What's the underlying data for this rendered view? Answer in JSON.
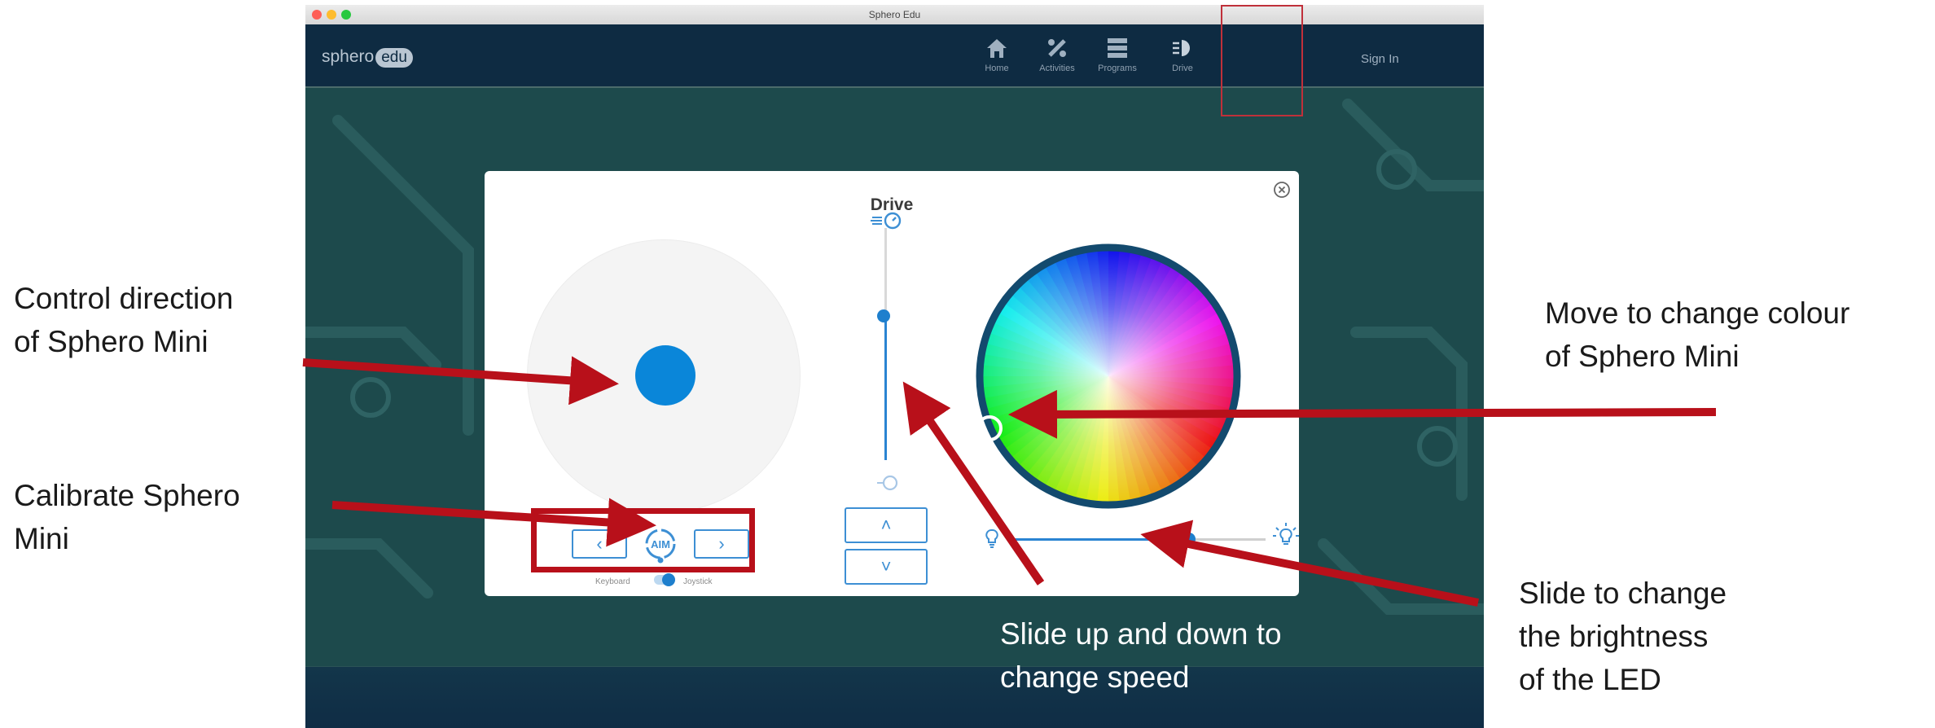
{
  "window": {
    "title": "Sphero Edu",
    "traffic_lights": [
      "#fe5f57",
      "#febc2e",
      "#28c840"
    ]
  },
  "navbar": {
    "logo_text": "sphero",
    "logo_badge": "edu",
    "items": [
      {
        "label": "Home",
        "icon": "home-icon"
      },
      {
        "label": "Activities",
        "icon": "activities-icon"
      },
      {
        "label": "Programs",
        "icon": "programs-icon"
      },
      {
        "label": "Drive",
        "icon": "drive-icon"
      }
    ],
    "sign_in": "Sign In"
  },
  "drive_panel": {
    "title": "Drive",
    "aim_label": "AIM",
    "prev_label": "‹",
    "next_label": "›",
    "toggle_left": "Keyboard",
    "toggle_right": "Joystick",
    "speed_up_label": "˄",
    "speed_down_label": "˅",
    "speed_level": 0.62,
    "brightness_level": 0.7,
    "accent_color": "#0a86d9"
  },
  "annotations": {
    "direction": "Control direction\nof Sphero Mini",
    "calibrate": "Calibrate Sphero\nMini",
    "colour": "Move to change colour\nof Sphero Mini",
    "brightness": "Slide to change\nthe brightness\nof the LED",
    "speed": "Slide up and down to\nchange speed",
    "arrow_color": "#b8101a"
  }
}
